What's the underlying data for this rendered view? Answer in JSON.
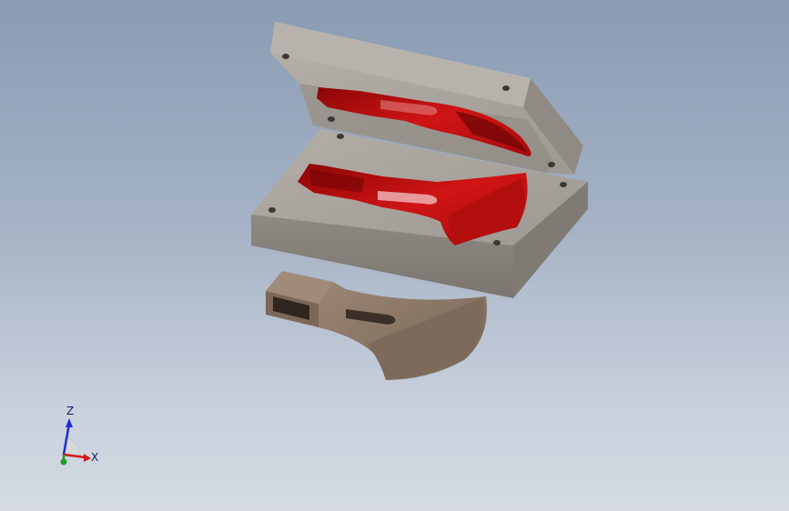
{
  "scene": {
    "background_top": "#8a9bb3",
    "background_bottom": "#d6dbe4",
    "mold_color": "#a39f98",
    "cavity_color": "#c20f0f",
    "part_color": "#8a7565"
  },
  "triad": {
    "z_label": "Z",
    "x_label": "X",
    "x_color": "#d11a1a",
    "y_color": "#1aa31a",
    "z_color": "#1a2fd1"
  }
}
